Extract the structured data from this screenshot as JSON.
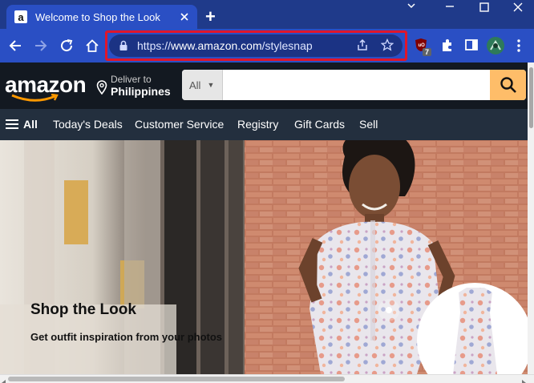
{
  "browser": {
    "tab_title": "Welcome to Shop the Look",
    "favicon_letter": "a",
    "url_prefix": "https://",
    "url_host": "www.amazon.com",
    "url_path": "/stylesnap",
    "extension_badge": "7"
  },
  "amazon": {
    "logo": "amazon",
    "deliver_label": "Deliver to",
    "deliver_location": "Philippines",
    "search_category": "All",
    "search_placeholder": ""
  },
  "nav": {
    "all": "All",
    "items": [
      "Today's Deals",
      "Customer Service",
      "Registry",
      "Gift Cards",
      "Sell"
    ]
  },
  "hero": {
    "title": "Shop the Look",
    "subtitle": "Get outfit inspiration from your photos"
  },
  "colors": {
    "browser_frame": "#1f3a8a",
    "toolbar": "#2a4fc4",
    "highlight": "#e0162b",
    "amazon_dark": "#131921",
    "amazon_nav": "#232f3e",
    "search_button": "#febd69"
  }
}
